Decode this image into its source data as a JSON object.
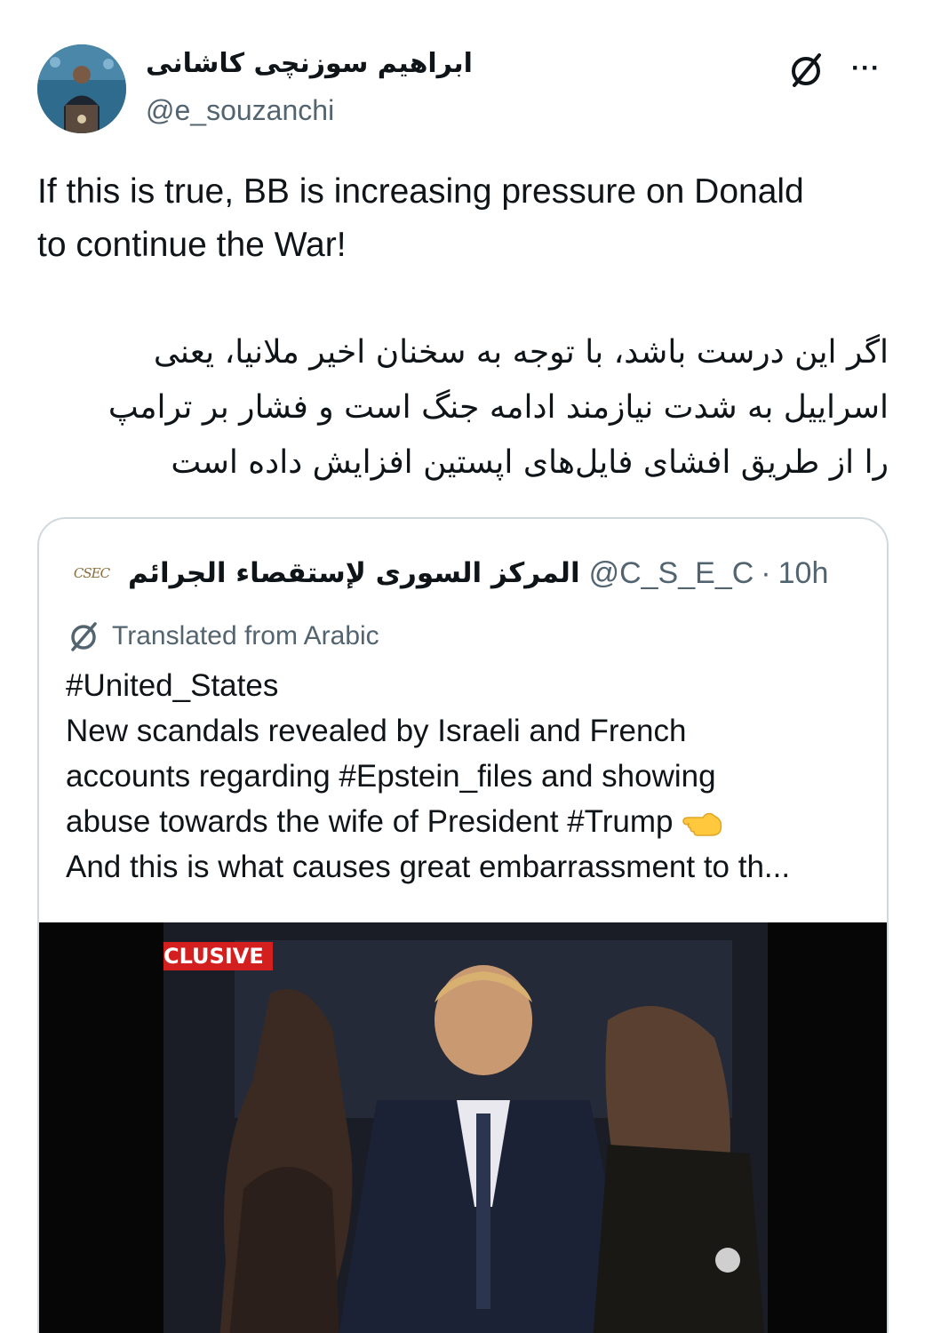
{
  "author": {
    "display_name": "ابراهیم سوزنچی کاشانی",
    "handle": "@e_souzanchi"
  },
  "icons": {
    "translate": "translate-icon",
    "more": "more-options-icon",
    "avatar": "avatar-image",
    "quote_logo": "csec-logo",
    "pointing_hand": "backhand-index-pointing-left-emoji"
  },
  "more_label": "···",
  "tweet": {
    "text_en": "If this is true, BB is increasing pressure on Donald\nto continue the War!",
    "text_fa": "اگر این درست باشد، با توجه به سخنان اخیر ملانیا، یعنی\nاسراییل به شدت نیازمند ادامه جنگ است و فشار بر ترامپ\nرا از طریق افشای فایل‌های اپستین افزایش داده است"
  },
  "quoted_tweet": {
    "logo_text": "CSEC",
    "display_name": "المركز السورى لإستقصاء الجرائم",
    "handle": "@C_S_E_C",
    "separator": "·",
    "time": "10h",
    "translated_label": "Translated from Arabic",
    "text": "#United_States\nNew scandals revealed by Israeli and French\naccounts regarding #Epstein_files and showing\nabuse towards the wife of President #Trump ",
    "text_last_line": "And this is what causes great embarrassment to th...",
    "video": {
      "badge": "CLUSIVE"
    }
  }
}
